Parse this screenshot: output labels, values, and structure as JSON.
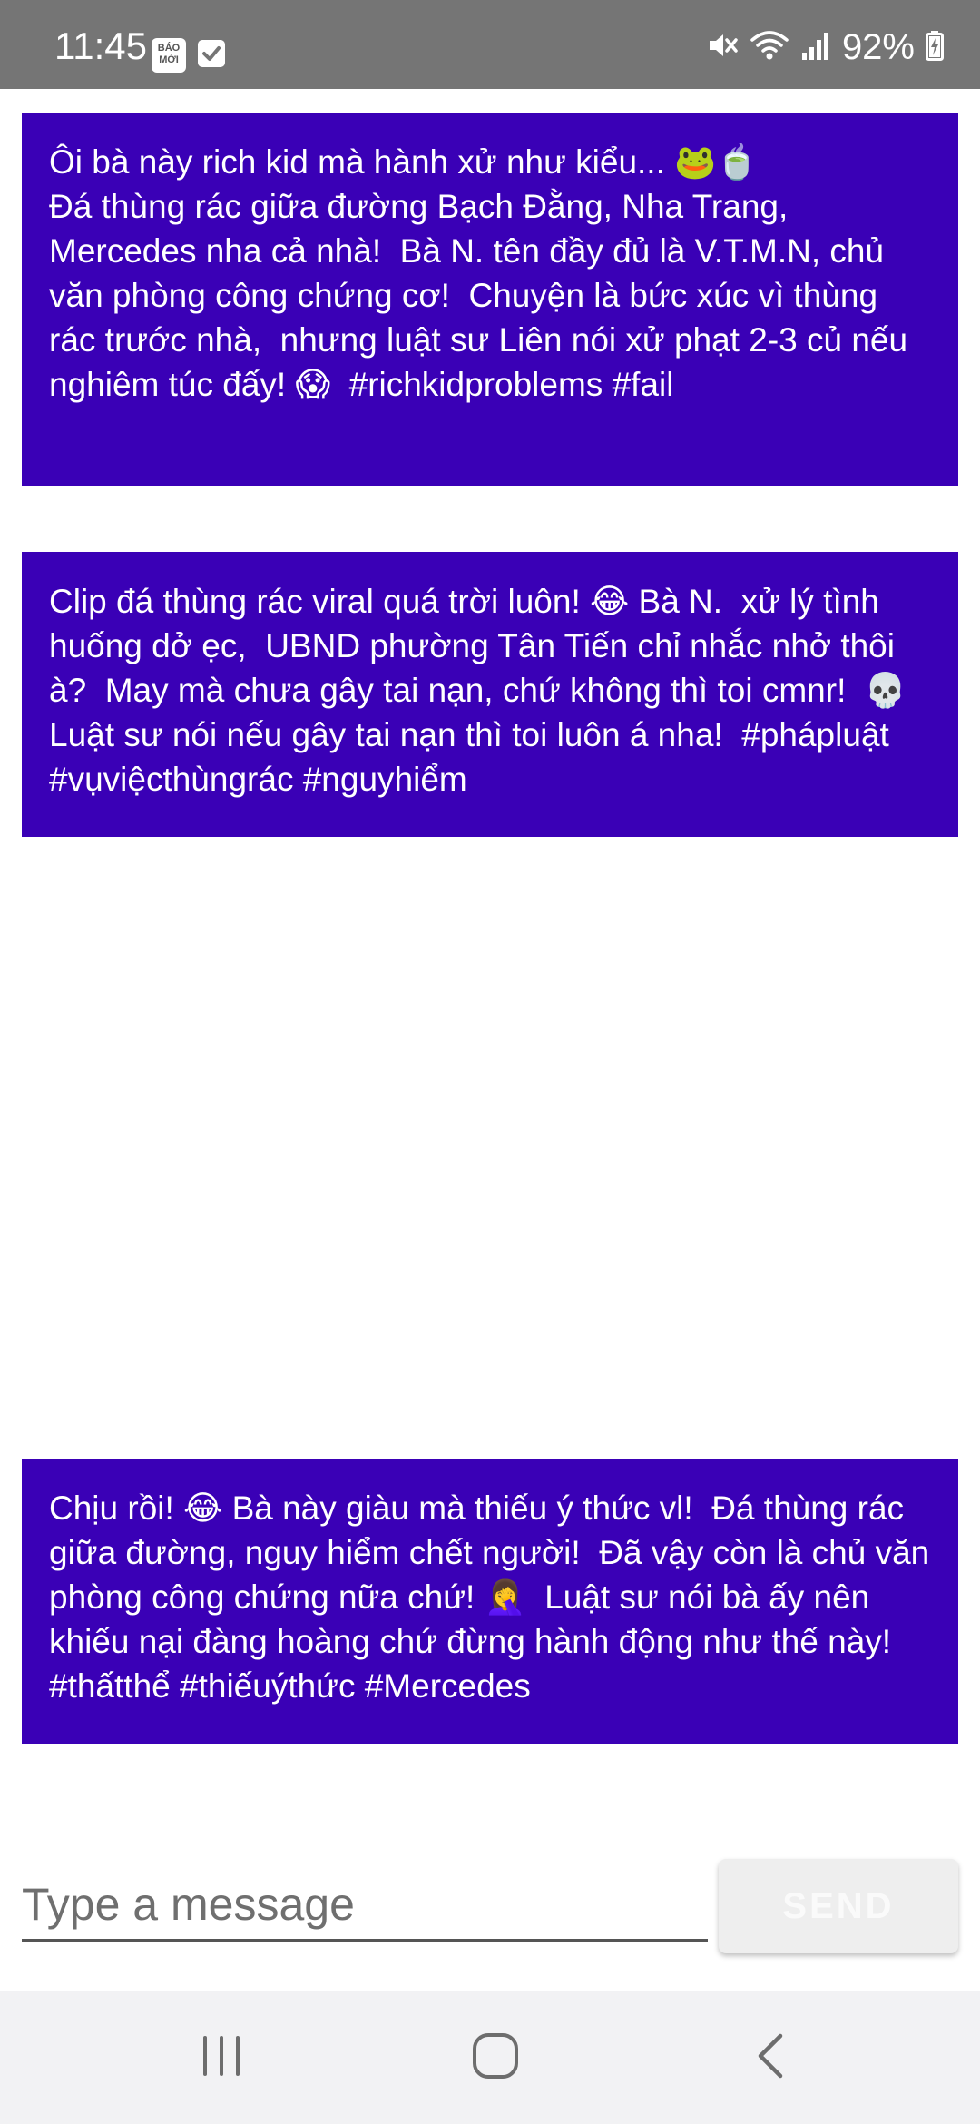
{
  "status_bar": {
    "time": "11:45",
    "app_icon_label": "BÁO MỚI",
    "battery": "92%",
    "icons": [
      "baomoi-app-icon",
      "checkbox-icon",
      "mute-icon",
      "wifi-icon",
      "signal-icon",
      "battery-charging-icon"
    ]
  },
  "messages": [
    {
      "text": "Ôi bà này rich kid mà hành xử như kiểu... 🐸🍵\nĐá thùng rác giữa đường Bạch Đằng, Nha Trang, Mercedes nha cả nhà!  Bà N. tên đầy đủ là V.T.M.N, chủ văn phòng công chứng cơ!  Chuyện là bức xúc vì thùng rác trước nhà,  nhưng luật sư Liên nói xử phạt 2-3 củ nếu nghiêm túc đấy! 😱  #richkidproblems #fail"
    },
    {
      "text": "Clip đá thùng rác viral quá trời luôn! 😂 Bà N.  xử lý tình huống dở ẹc,  UBND phường Tân Tiến chỉ nhắc nhở thôi à?  May mà chưa gây tai nạn, chứ không thì toi cmnr!  💀  Luật sư nói nếu gây tai nạn thì toi luôn á nha!  #phápluật #vụviệcthùngrác #nguyhiểm"
    },
    {
      "text": "Chịu rồi! 😂 Bà này giàu mà thiếu ý thức vl!  Đá thùng rác giữa đường, nguy hiểm chết người!  Đã vậy còn là chủ văn phòng công chứng nữa chứ! 🤦‍♀️  Luật sư nói bà ấy nên khiếu nại đàng hoàng chứ đừng hành động như thế này!  #thấtthể #thiếuýthức #Mercedes"
    }
  ],
  "composer": {
    "placeholder": "Type a message",
    "send_label": "SEND"
  },
  "colors": {
    "status_bar_bg": "#757575",
    "message_bg": "#3a00b6",
    "message_text": "#ffffff",
    "nav_bar_bg": "#f2f2f4"
  },
  "nav_bar": {
    "buttons": [
      "recents-icon",
      "home-icon",
      "back-icon"
    ]
  }
}
